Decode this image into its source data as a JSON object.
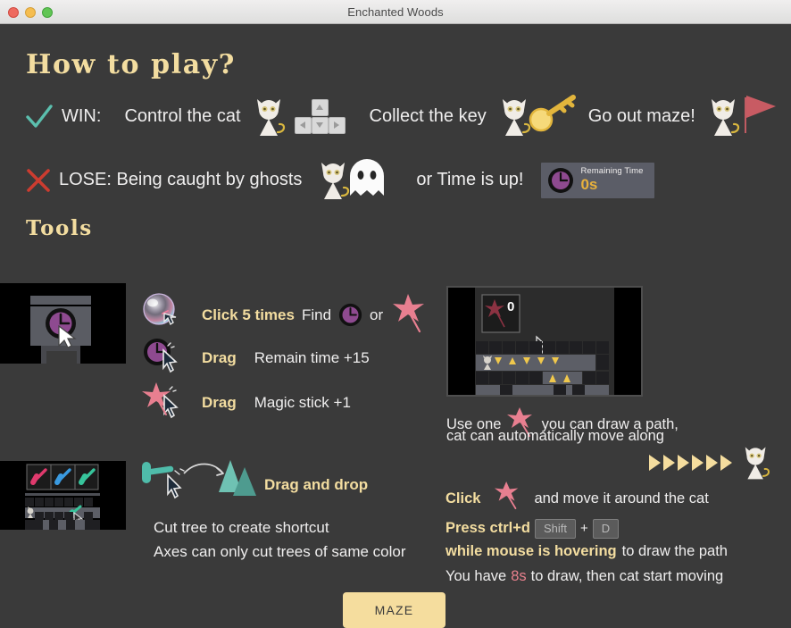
{
  "window": {
    "title": "Enchanted Woods",
    "traffic_lights": [
      "close",
      "minimize",
      "zoom"
    ]
  },
  "headings": {
    "how_to_play": "How to play?",
    "tools": "Tools"
  },
  "win_row": {
    "icon": "check-icon",
    "label": "WIN:",
    "control": "Control the cat",
    "collect": "Collect the key",
    "goout": "Go out maze!"
  },
  "lose_row": {
    "icon": "x-icon",
    "label": "LOSE: Being caught by ghosts",
    "or_time": "or Time is up!",
    "timer": {
      "caption": "Remaining Time",
      "value": "0s"
    }
  },
  "tools": {
    "click_row": {
      "action": "Click 5 times",
      "find": "Find",
      "or": "or"
    },
    "drag_time": {
      "action": "Drag",
      "effect": "Remain time +15"
    },
    "drag_magic": {
      "action": "Drag",
      "effect": "Magic stick +1"
    },
    "axe": {
      "action": "Drag and drop",
      "line1": "Cut tree to create shortcut",
      "line2": "Axes can only cut trees of same color"
    }
  },
  "path_panel": {
    "counter": "0",
    "line1_a": "Use one",
    "line1_b": "you can draw a path,",
    "line2": "cat can automatically move along",
    "click_label": "Click",
    "click_rest": "and move it around the cat",
    "press_label": "Press ctrl+d",
    "key_shift": "Shift",
    "key_plus": "+",
    "key_d": "D",
    "hover_label": "while mouse is hovering",
    "hover_rest": "to draw the path",
    "timing_a": "You have",
    "timing_b": "8s",
    "timing_c": "to draw,  then cat start moving"
  },
  "footer": {
    "maze_button": "MAZE"
  },
  "colors": {
    "background": "#3a3a3a",
    "gold": "#f3dda0",
    "gold_button": "#f5dd9e",
    "pink": "#e8808d",
    "teal": "#5bbfae",
    "red": "#cc3c30",
    "timer_panel": "#5b5d67",
    "purple": "#8e4a90"
  }
}
